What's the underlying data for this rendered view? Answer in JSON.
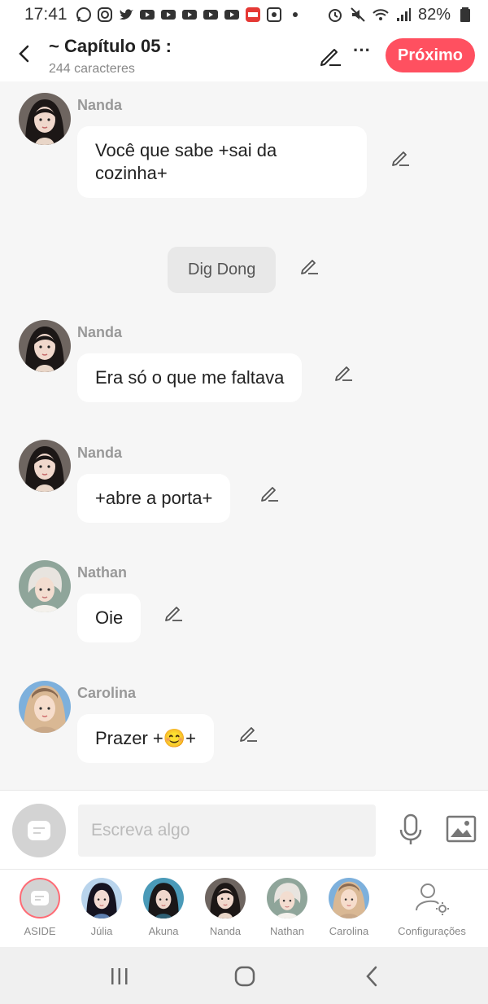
{
  "status_bar": {
    "time": "17:41",
    "battery": "82%"
  },
  "header": {
    "title": "~ Capítulo 05 :",
    "char_count": "244 caracteres",
    "next_label": "Próximo"
  },
  "messages": [
    {
      "author": "Nanda",
      "text": "Você que sabe +sai da cozinha+"
    },
    {
      "text": "Dig Dong"
    },
    {
      "author": "Nanda",
      "text": "Era só o que me faltava"
    },
    {
      "author": "Nanda",
      "text": "+abre a porta+"
    },
    {
      "author": "Nathan",
      "text": "Oie"
    },
    {
      "author": "Carolina",
      "text": "Prazer +😊+"
    }
  ],
  "composer": {
    "placeholder": "Escreva algo"
  },
  "characters": [
    {
      "label": "ASIDE"
    },
    {
      "label": "Júlia"
    },
    {
      "label": "Akuna"
    },
    {
      "label": "Nanda"
    },
    {
      "label": "Nathan"
    },
    {
      "label": "Carolina"
    },
    {
      "label": "Configurações"
    }
  ],
  "colors": {
    "accent": "#ff5060",
    "background": "#f6f6f6",
    "bubble": "#ffffff",
    "system_bubble": "#e8e8e8"
  }
}
